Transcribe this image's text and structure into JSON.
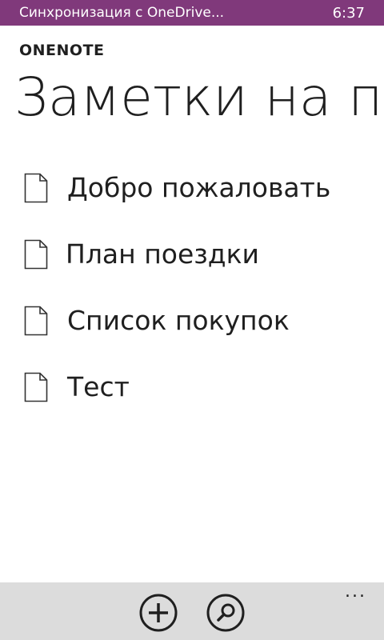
{
  "status_bar": {
    "text": "Синхронизация с OneDrive...",
    "time": "6:37",
    "color": "#80397b"
  },
  "header": {
    "app_name": "ONENOTE",
    "title": "Заметки на по"
  },
  "notes": [
    {
      "label": "Добро пожаловать",
      "icon": "page-icon"
    },
    {
      "label": "План поездки",
      "icon": "page-icon"
    },
    {
      "label": "Список покупок",
      "icon": "page-icon"
    },
    {
      "label": "Тест",
      "icon": "page-icon"
    }
  ],
  "app_bar": {
    "buttons": [
      {
        "icon": "add-icon"
      },
      {
        "icon": "search-icon"
      }
    ],
    "more_label": "..."
  }
}
